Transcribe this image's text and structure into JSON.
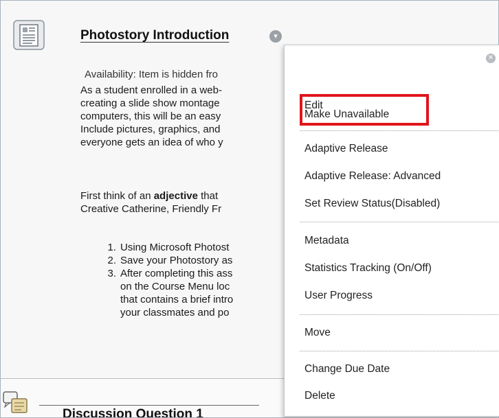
{
  "item": {
    "title": "Photostory Introduction",
    "menu_button_icon": "chevron-down-icon",
    "availability": "Availability:  Item is hidden fro",
    "body_lines": [
      "As a student enrolled in a web-",
      "creating a slide show montage",
      "computers, this will be an easy",
      "Include pictures, graphics, and",
      "everyone gets an idea of who y"
    ],
    "para2_line1_prefix": "First think of an ",
    "para2_line1_bold": "adjective",
    "para2_line1_suffix": " that",
    "para2_line2": "Creative Catherine, Friendly Fr",
    "steps": [
      {
        "num": "1.",
        "text": "Using Microsoft Photost"
      },
      {
        "num": "2.",
        "text": "Save your Photostory as"
      },
      {
        "num": "3.",
        "text": "After completing this ass"
      }
    ],
    "step3_cont": [
      "on the Course Menu loc",
      "that contains a brief intro",
      "your classmates and po"
    ]
  },
  "item2": {
    "title": "Discussion Question 1"
  },
  "menu": {
    "close_icon": "close-icon",
    "items": [
      "Edit",
      "Make Unavailable",
      "Adaptive Release",
      "Adaptive Release: Advanced",
      "Set Review Status(Disabled)",
      "Metadata",
      "Statistics Tracking (On/Off)",
      "User Progress",
      "Move",
      "Change Due Date",
      "Delete"
    ],
    "highlight_color": "#e0141b"
  }
}
